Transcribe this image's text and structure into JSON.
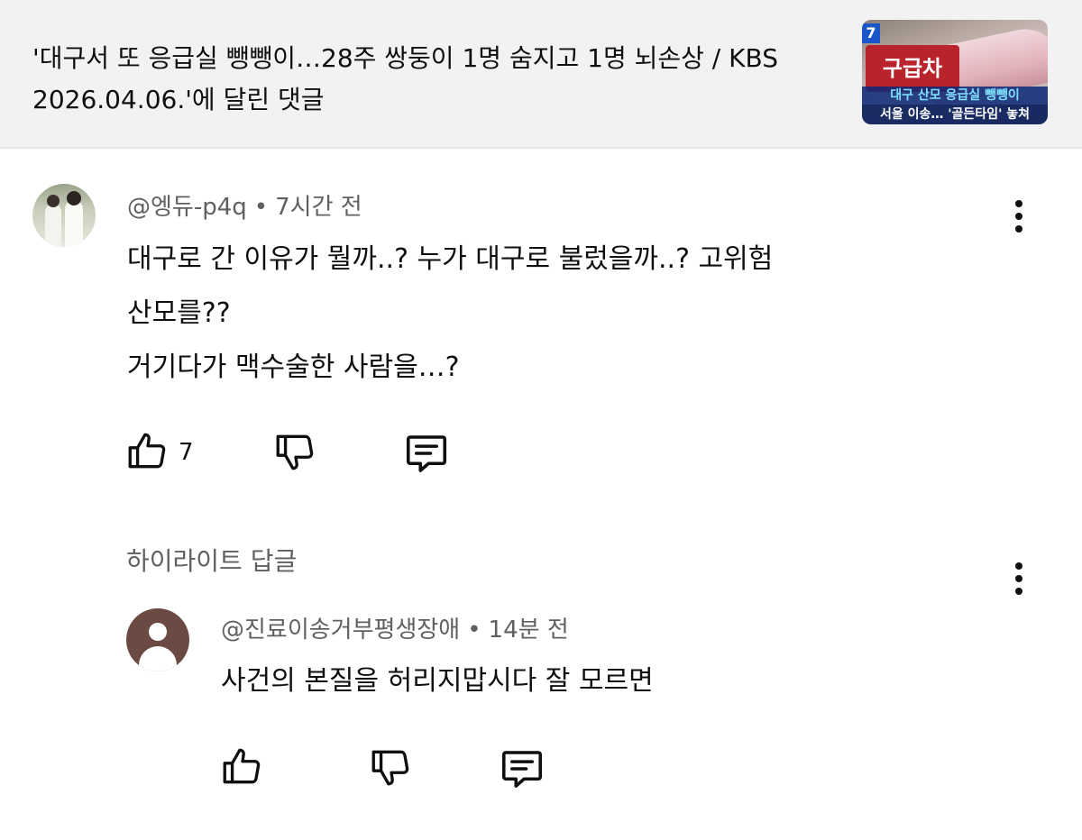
{
  "header": {
    "title_line1": "'대구서 또 응급실 뺑뺑이…28주 쌍둥이 1명 숨지고 1명 뇌손상 / KBS",
    "title_line2": "2026.04.06.'에 달린 댓글",
    "thumbnail": {
      "channel_badge": "7",
      "sign_text": "구급차",
      "caption1": "대구 산모 응급실 뺑뺑이",
      "caption2": "서울 이송… '골든타임' 놓쳐"
    }
  },
  "comment": {
    "author": "@엥듀-p4q",
    "separator": "•",
    "time": "7시간 전",
    "lines": [
      "대구로 간 이유가 뭘까..? 누가 대구로 불렀을까..? 고위험",
      "산모를??",
      "거기다가 맥수술한 사람을…?"
    ],
    "like_count": "7"
  },
  "highlight": {
    "label": "하이라이트 답글"
  },
  "reply": {
    "author": "@진료이송거부평생장애",
    "separator": "•",
    "time": "14분 전",
    "text": "사건의 본질을 허리지맙시다 잘 모르면"
  }
}
